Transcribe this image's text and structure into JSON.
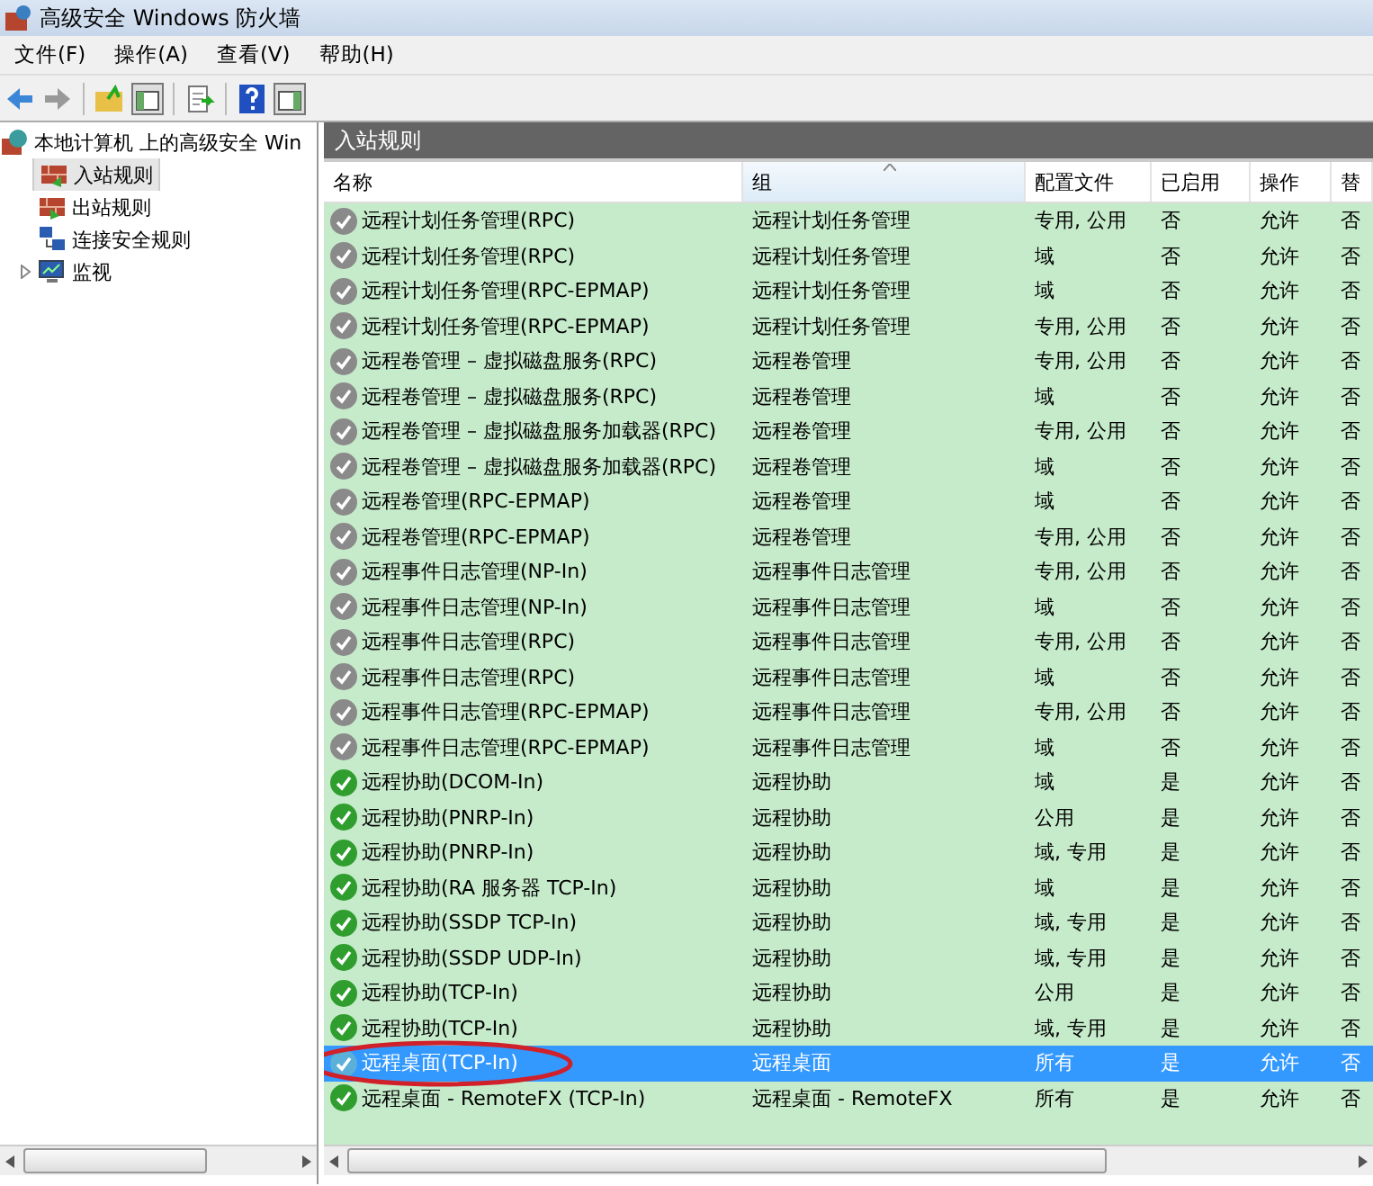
{
  "window": {
    "title": "高级安全 Windows 防火墙"
  },
  "menu": [
    "文件(F)",
    "操作(A)",
    "查看(V)",
    "帮助(H)"
  ],
  "tree": {
    "label": "本地计算机 上的高级安全 Win",
    "children": [
      {
        "label": "入站规则",
        "kind": "inbound",
        "selected": true
      },
      {
        "label": "出站规则",
        "kind": "outbound",
        "selected": false
      },
      {
        "label": "连接安全规则",
        "kind": "connection",
        "selected": false
      },
      {
        "label": "监视",
        "kind": "monitor",
        "selected": false,
        "expanded": false
      }
    ]
  },
  "panel": {
    "title": "入站规则"
  },
  "table": {
    "columns": [
      {
        "label": "名称",
        "sorted": false
      },
      {
        "label": "组",
        "sorted": true
      },
      {
        "label": "配置文件",
        "sorted": false
      },
      {
        "label": "已启用",
        "sorted": false
      },
      {
        "label": "操作",
        "sorted": false
      },
      {
        "label": "替",
        "sorted": false
      }
    ],
    "rows": [
      {
        "cells": [
          "远程计划任务管理(RPC)",
          "远程计划任务管理",
          "专用, 公用",
          "否",
          "允许",
          "否"
        ],
        "enabled": false,
        "selected": false
      },
      {
        "cells": [
          "远程计划任务管理(RPC)",
          "远程计划任务管理",
          "域",
          "否",
          "允许",
          "否"
        ],
        "enabled": false,
        "selected": false
      },
      {
        "cells": [
          "远程计划任务管理(RPC-EPMAP)",
          "远程计划任务管理",
          "域",
          "否",
          "允许",
          "否"
        ],
        "enabled": false,
        "selected": false
      },
      {
        "cells": [
          "远程计划任务管理(RPC-EPMAP)",
          "远程计划任务管理",
          "专用, 公用",
          "否",
          "允许",
          "否"
        ],
        "enabled": false,
        "selected": false
      },
      {
        "cells": [
          "远程卷管理 – 虚拟磁盘服务(RPC)",
          "远程卷管理",
          "专用, 公用",
          "否",
          "允许",
          "否"
        ],
        "enabled": false,
        "selected": false
      },
      {
        "cells": [
          "远程卷管理 – 虚拟磁盘服务(RPC)",
          "远程卷管理",
          "域",
          "否",
          "允许",
          "否"
        ],
        "enabled": false,
        "selected": false
      },
      {
        "cells": [
          "远程卷管理 – 虚拟磁盘服务加载器(RPC)",
          "远程卷管理",
          "专用, 公用",
          "否",
          "允许",
          "否"
        ],
        "enabled": false,
        "selected": false
      },
      {
        "cells": [
          "远程卷管理 – 虚拟磁盘服务加载器(RPC)",
          "远程卷管理",
          "域",
          "否",
          "允许",
          "否"
        ],
        "enabled": false,
        "selected": false
      },
      {
        "cells": [
          "远程卷管理(RPC-EPMAP)",
          "远程卷管理",
          "域",
          "否",
          "允许",
          "否"
        ],
        "enabled": false,
        "selected": false
      },
      {
        "cells": [
          "远程卷管理(RPC-EPMAP)",
          "远程卷管理",
          "专用, 公用",
          "否",
          "允许",
          "否"
        ],
        "enabled": false,
        "selected": false
      },
      {
        "cells": [
          "远程事件日志管理(NP-In)",
          "远程事件日志管理",
          "专用, 公用",
          "否",
          "允许",
          "否"
        ],
        "enabled": false,
        "selected": false
      },
      {
        "cells": [
          "远程事件日志管理(NP-In)",
          "远程事件日志管理",
          "域",
          "否",
          "允许",
          "否"
        ],
        "enabled": false,
        "selected": false
      },
      {
        "cells": [
          "远程事件日志管理(RPC)",
          "远程事件日志管理",
          "专用, 公用",
          "否",
          "允许",
          "否"
        ],
        "enabled": false,
        "selected": false
      },
      {
        "cells": [
          "远程事件日志管理(RPC)",
          "远程事件日志管理",
          "域",
          "否",
          "允许",
          "否"
        ],
        "enabled": false,
        "selected": false
      },
      {
        "cells": [
          "远程事件日志管理(RPC-EPMAP)",
          "远程事件日志管理",
          "专用, 公用",
          "否",
          "允许",
          "否"
        ],
        "enabled": false,
        "selected": false
      },
      {
        "cells": [
          "远程事件日志管理(RPC-EPMAP)",
          "远程事件日志管理",
          "域",
          "否",
          "允许",
          "否"
        ],
        "enabled": false,
        "selected": false
      },
      {
        "cells": [
          "远程协助(DCOM-In)",
          "远程协助",
          "域",
          "是",
          "允许",
          "否"
        ],
        "enabled": true,
        "selected": false
      },
      {
        "cells": [
          "远程协助(PNRP-In)",
          "远程协助",
          "公用",
          "是",
          "允许",
          "否"
        ],
        "enabled": true,
        "selected": false
      },
      {
        "cells": [
          "远程协助(PNRP-In)",
          "远程协助",
          "域, 专用",
          "是",
          "允许",
          "否"
        ],
        "enabled": true,
        "selected": false
      },
      {
        "cells": [
          "远程协助(RA 服务器 TCP-In)",
          "远程协助",
          "域",
          "是",
          "允许",
          "否"
        ],
        "enabled": true,
        "selected": false
      },
      {
        "cells": [
          "远程协助(SSDP TCP-In)",
          "远程协助",
          "域, 专用",
          "是",
          "允许",
          "否"
        ],
        "enabled": true,
        "selected": false
      },
      {
        "cells": [
          "远程协助(SSDP UDP-In)",
          "远程协助",
          "域, 专用",
          "是",
          "允许",
          "否"
        ],
        "enabled": true,
        "selected": false
      },
      {
        "cells": [
          "远程协助(TCP-In)",
          "远程协助",
          "公用",
          "是",
          "允许",
          "否"
        ],
        "enabled": true,
        "selected": false
      },
      {
        "cells": [
          "远程协助(TCP-In)",
          "远程协助",
          "域, 专用",
          "是",
          "允许",
          "否"
        ],
        "enabled": true,
        "selected": false
      },
      {
        "cells": [
          "远程桌面(TCP-In)",
          "远程桌面",
          "所有",
          "是",
          "允许",
          "否"
        ],
        "enabled": true,
        "selected": true,
        "circled": true
      },
      {
        "cells": [
          "远程桌面 - RemoteFX (TCP-In)",
          "远程桌面 - RemoteFX",
          "所有",
          "是",
          "允许",
          "否"
        ],
        "enabled": true,
        "selected": false
      }
    ]
  }
}
